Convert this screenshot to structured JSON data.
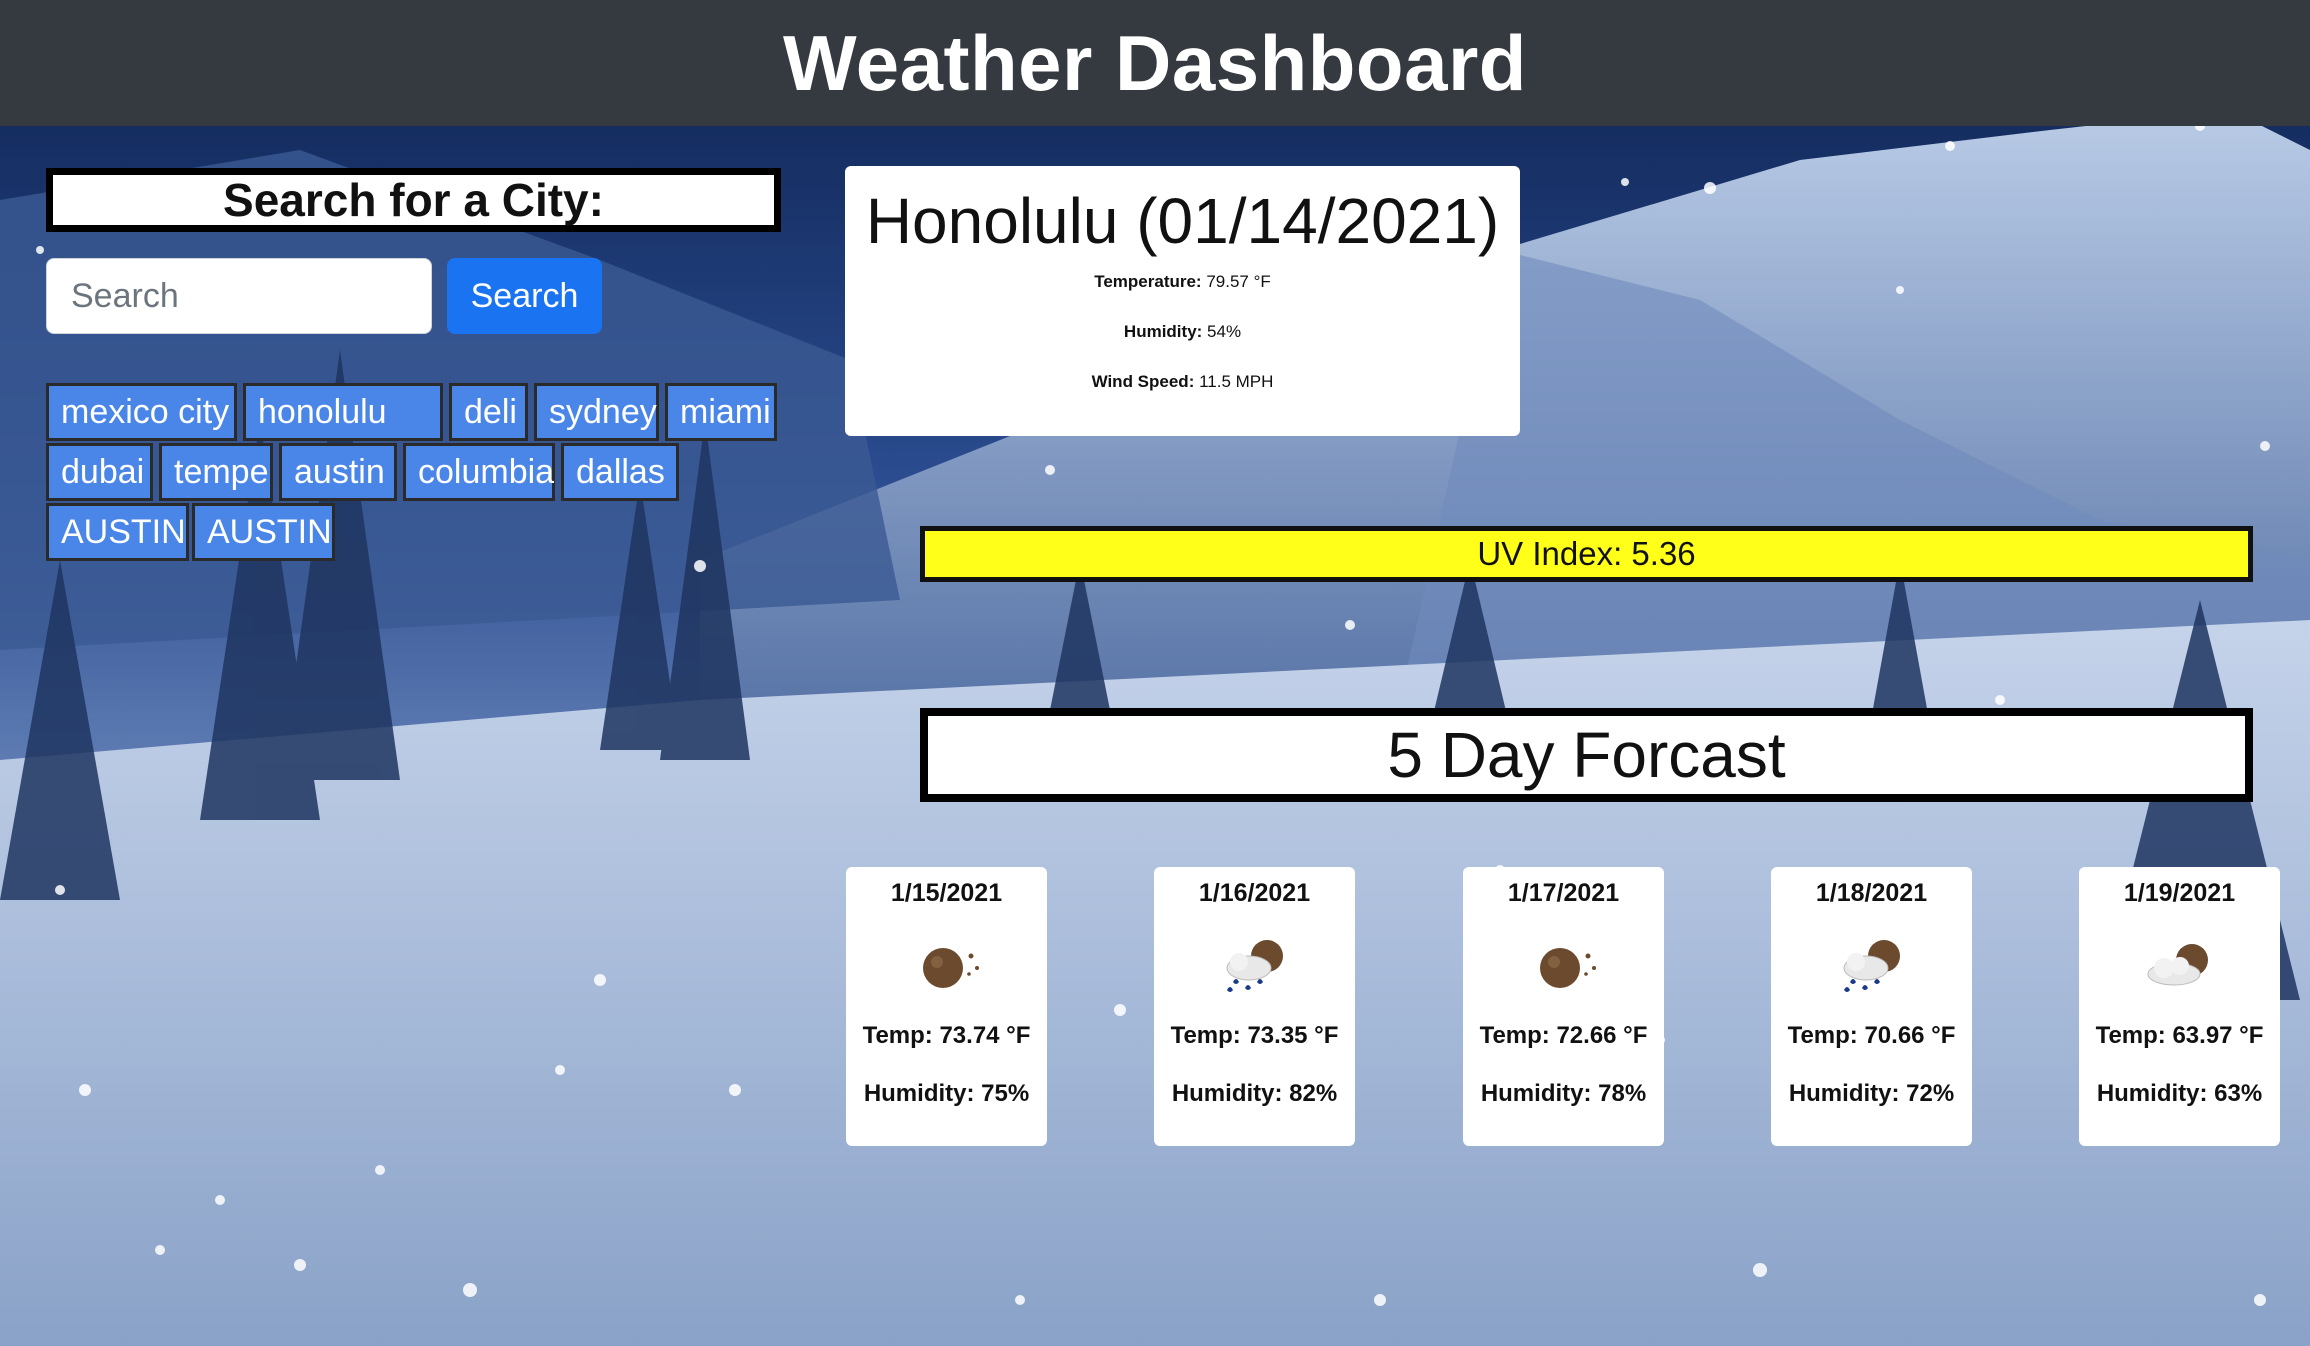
{
  "header": {
    "title": "Weather Dashboard"
  },
  "search": {
    "title": "Search for a City:",
    "input_value": "",
    "placeholder": "Search",
    "button_label": "Search"
  },
  "history": [
    "mexico city",
    "honolulu",
    "deli",
    "sydney",
    "miami",
    "dubai",
    "tempe",
    "austin",
    "columbia",
    "dallas",
    "AUSTIN",
    "AUSTIN"
  ],
  "current": {
    "title": "Honolulu (01/14/2021)",
    "temperature_label": "Temperature:",
    "temperature_value": " 79.57 °F",
    "humidity_label": "Humidity:",
    "humidity_value": " 54%",
    "wind_label": "Wind Speed:",
    "wind_value": " 11.5 MPH"
  },
  "uv": {
    "text": "UV Index: 5.36",
    "color": "#ffff1a"
  },
  "forecast": {
    "title": "5 Day Forcast",
    "days": [
      {
        "date": "1/15/2021",
        "icon": "night-clear-icon",
        "temp": "Temp: 73.74 °F",
        "humidity": "Humidity: 75%"
      },
      {
        "date": "1/16/2021",
        "icon": "night-rain-icon",
        "temp": "Temp: 73.35 °F",
        "humidity": "Humidity: 82%"
      },
      {
        "date": "1/17/2021",
        "icon": "night-clear-icon",
        "temp": "Temp: 72.66 °F",
        "humidity": "Humidity: 78%"
      },
      {
        "date": "1/18/2021",
        "icon": "night-rain-icon",
        "temp": "Temp: 70.66 °F",
        "humidity": "Humidity: 72%"
      },
      {
        "date": "1/19/2021",
        "icon": "night-cloudy-icon",
        "temp": "Temp: 63.97 °F",
        "humidity": "Humidity: 63%"
      }
    ]
  },
  "colors": {
    "header_bg": "#343a40",
    "search_button": "#1a73f0",
    "history_button": "#4a86e8",
    "uv_highlight": "#ffff1a"
  }
}
